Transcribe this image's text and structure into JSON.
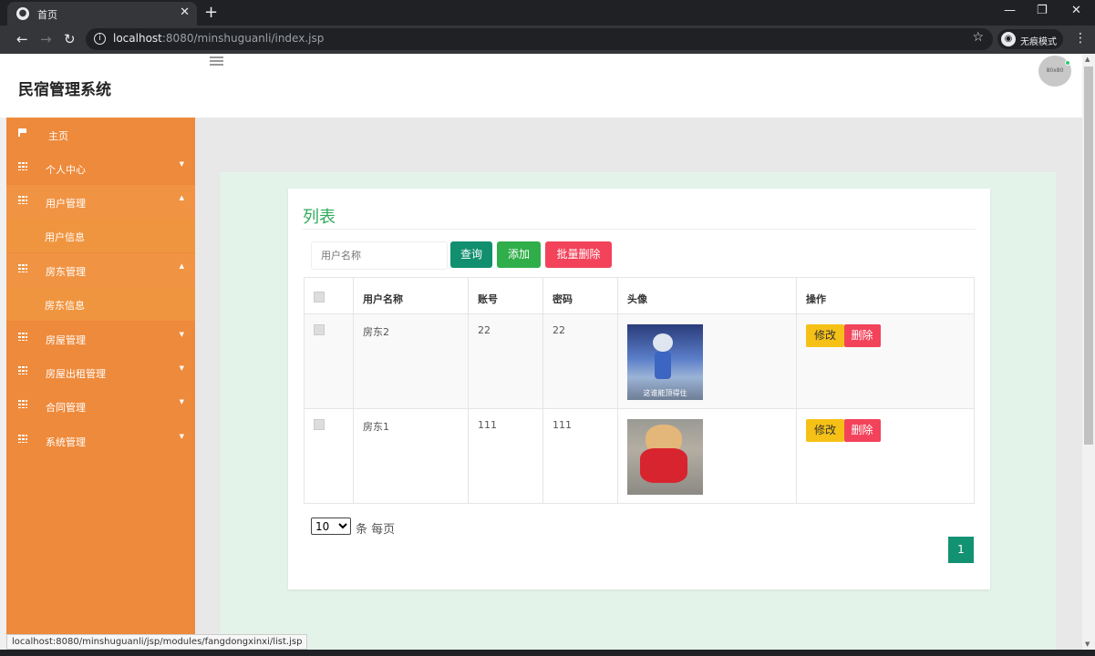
{
  "browser": {
    "tab_title": "首页",
    "tab_icon": "globe-icon",
    "url_host": "localhost",
    "url_rest": ":8080/minshuguanli/index.jsp",
    "incognito_label": "无痕模式",
    "status_url": "localhost:8080/minshuguanli/jsp/modules/fangdongxinxi/list.jsp"
  },
  "header": {
    "title": "民宿管理系统",
    "avatar_text": "80x80"
  },
  "sidebar": {
    "items": [
      {
        "label": "主页",
        "icon": "flag-icon"
      },
      {
        "label": "个人中心",
        "icon": "grid-icon"
      },
      {
        "label": "用户管理",
        "icon": "grid-icon",
        "sub": "用户信息"
      },
      {
        "label": "房东管理",
        "icon": "grid-icon",
        "sub": "房东信息"
      },
      {
        "label": "房屋管理",
        "icon": "grid-icon"
      },
      {
        "label": "房屋出租管理",
        "icon": "grid-icon"
      },
      {
        "label": "合同管理",
        "icon": "grid-icon"
      },
      {
        "label": "系统管理",
        "icon": "grid-icon"
      }
    ]
  },
  "card": {
    "title": "列表",
    "search_placeholder": "用户名称",
    "query_label": "查询",
    "add_label": "添加",
    "batch_delete_label": "批量删除"
  },
  "table": {
    "headers": [
      "用户名称",
      "账号",
      "密码",
      "头像",
      "操作"
    ],
    "rows": [
      {
        "name": "房东2",
        "account": "22",
        "password": "22",
        "avatar_caption": "这谁能顶得住"
      },
      {
        "name": "房东1",
        "account": "111",
        "password": "111",
        "avatar_caption": ""
      }
    ],
    "edit_label": "修改",
    "delete_label": "删除"
  },
  "pagination": {
    "page_size": "10",
    "page_size_suffix": "条 每页",
    "current_page": "1"
  },
  "colors": {
    "sidebar": "#ee8a3b",
    "accent_green": "#33aa5c",
    "danger": "#f2435a",
    "warning": "#f6c117"
  }
}
